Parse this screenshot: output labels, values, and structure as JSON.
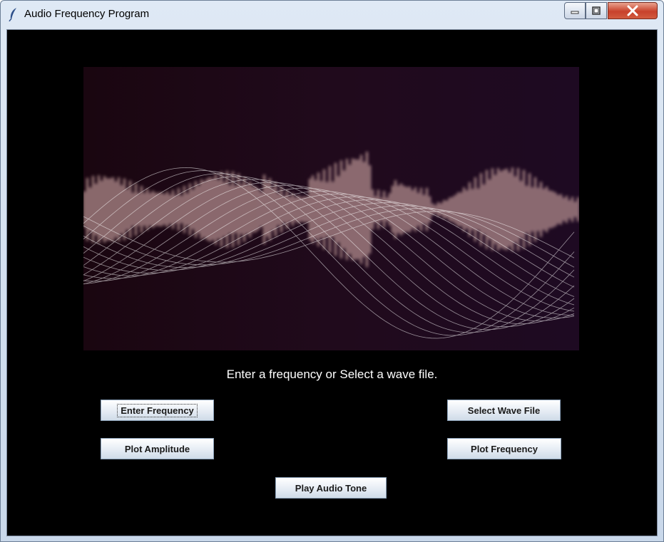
{
  "window": {
    "title": "Audio Frequency Program",
    "icon": "feather-icon",
    "controls": [
      "minimize-icon",
      "maximize-icon",
      "close-icon"
    ]
  },
  "main": {
    "banner_image": "audio-waveform-spectrum",
    "prompt": "Enter a frequency or Select a wave file.",
    "buttons": {
      "enter_frequency": "Enter Frequency",
      "select_wave_file": "Select Wave File",
      "plot_amplitude": "Plot Amplitude",
      "plot_frequency": "Plot Frequency",
      "play_audio_tone": "Play Audio Tone"
    }
  },
  "colors": {
    "background": "#000000",
    "prompt_text": "#ffffff",
    "close_button": "#c8412b"
  }
}
